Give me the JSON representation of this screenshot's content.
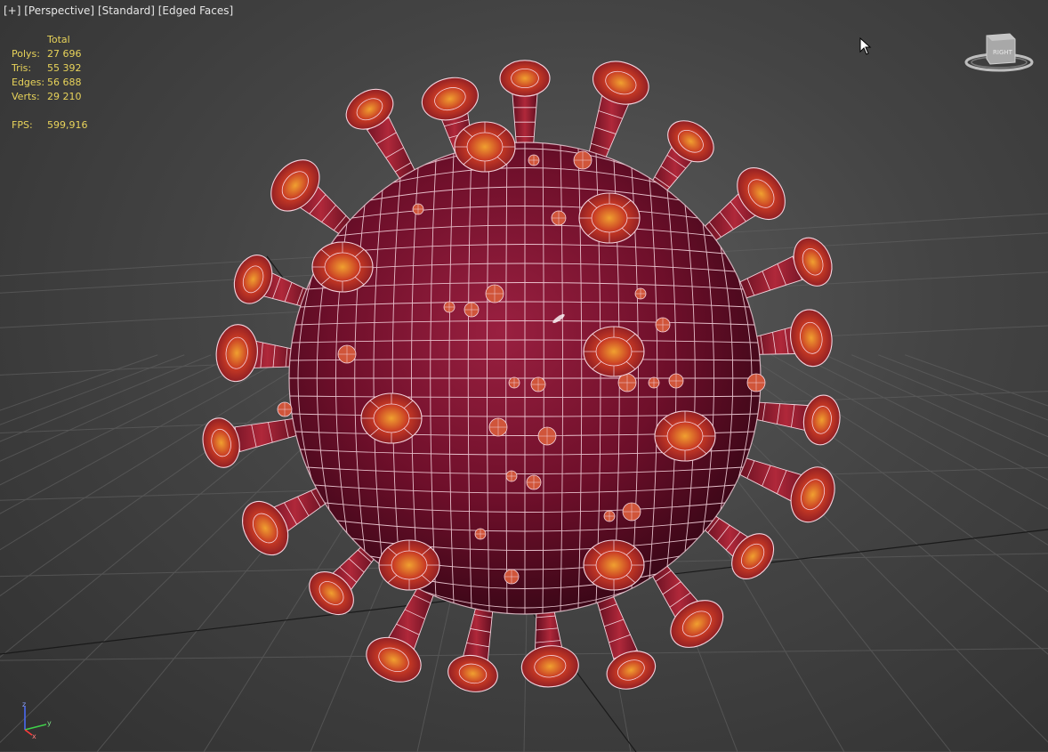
{
  "viewport": {
    "labels": [
      "[+]",
      "[Perspective]",
      "[Standard]",
      "[Edged Faces]"
    ]
  },
  "stats": {
    "header": "Total",
    "rows": [
      {
        "label": "Polys:",
        "value": "27 696"
      },
      {
        "label": "Tris:",
        "value": "55 392"
      },
      {
        "label": "Edges:",
        "value": "56 688"
      },
      {
        "label": "Verts:",
        "value": "29 210"
      }
    ],
    "fps_label": "FPS:",
    "fps_value": "599,916"
  },
  "viewcube": {
    "face_label": "RIGHT"
  },
  "axis": {
    "z": "z",
    "x": "x",
    "y": "y"
  },
  "colors": {
    "stats_text": "#e8d35a",
    "mesh_body": "#7a1028",
    "wire": "#f4d2dc",
    "spike_head": "#d3472a",
    "grid": "#5f5f5f"
  }
}
